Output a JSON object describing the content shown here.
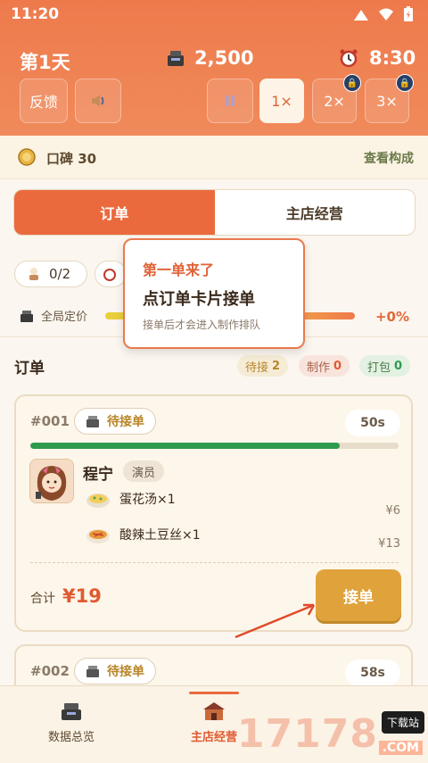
{
  "status_bar": {
    "time": "11:20"
  },
  "header": {
    "day": "第1天",
    "money": "2,500",
    "clock": "8:30",
    "buttons": {
      "feedback": "反馈",
      "speed_1": "1×",
      "speed_2": "2×",
      "speed_3": "3×"
    }
  },
  "reputation": {
    "label": "口碑 30",
    "link": "查看构成"
  },
  "tabs": [
    "订单",
    "主店经营"
  ],
  "stats": {
    "staff": "0/2",
    "pricing_label": "全局定价",
    "pricing_value": "+0%"
  },
  "tooltip": {
    "title": "第一单来了",
    "headline": "点订单卡片接单",
    "sub": "接单后才会进入制作排队"
  },
  "orders_section": {
    "title": "订单",
    "chips": [
      {
        "label": "待接",
        "count": "2",
        "color": "#b8862a"
      },
      {
        "label": "制作",
        "count": "0",
        "color": "#e05a30"
      },
      {
        "label": "打包",
        "count": "0",
        "color": "#2e9a4e"
      }
    ]
  },
  "order1": {
    "id": "#001",
    "status": "待接单",
    "timer": "50s",
    "progress": 0.84,
    "customer": "程宁",
    "role": "演员",
    "items": [
      {
        "name": "蛋花汤×1",
        "price": "¥6"
      },
      {
        "name": "酸辣土豆丝×1",
        "price": "¥13"
      }
    ],
    "total_label": "合计",
    "total": "¥19",
    "action": "接单"
  },
  "order2": {
    "id": "#002",
    "status": "待接单",
    "timer": "58s"
  },
  "bottom_nav": {
    "overview": "数据总览",
    "main_store": "主店经营"
  },
  "watermark": {
    "number": "17178",
    "tag": "下载站",
    "suffix": ".COM"
  },
  "colors": {
    "accent": "#ea6a3e",
    "header": "#ee7a4c",
    "accept": "#e0a33c"
  }
}
